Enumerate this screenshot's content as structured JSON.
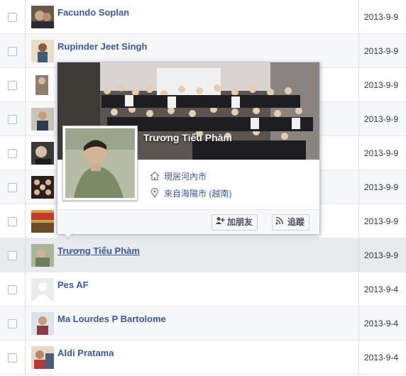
{
  "rows": [
    {
      "name": "Facundo Soplan",
      "date": "2013-9-9",
      "avatar": "photo"
    },
    {
      "name": "Rupinder Jeet Singh",
      "date": "2013-9-9",
      "avatar": "photo"
    },
    {
      "name": "",
      "date": "2013-9-9",
      "avatar": "photo"
    },
    {
      "name": "",
      "date": "2013-9-9",
      "avatar": "photo"
    },
    {
      "name": "",
      "date": "2013-9-9",
      "avatar": "photo"
    },
    {
      "name": "",
      "date": "2013-9-9",
      "avatar": "photo"
    },
    {
      "name": "",
      "date": "2013-9-9",
      "avatar": "photo"
    },
    {
      "name": "Trương Tiểu Phàm",
      "date": "2013-9-9",
      "avatar": "photo"
    },
    {
      "name": "Pes AF",
      "date": "2013-9-4",
      "avatar": "default-silhouette"
    },
    {
      "name": "Ma Lourdes P Bartolome",
      "date": "2013-9-4",
      "avatar": "photo"
    },
    {
      "name": "Aldi Pratama",
      "date": "2013-9-4",
      "avatar": "photo"
    }
  ],
  "hovercard": {
    "name": "Trương Tiểu Phàm",
    "lives_in": "現居河內市",
    "from": "來自海陽市 (越南)",
    "add_friend_label": "加朋友",
    "follow_label": "追蹤"
  },
  "colors": {
    "link": "#3b5998",
    "row_alt": "#f6f7f9",
    "row_highlight": "#e9eaed",
    "border": "#dddfe2"
  }
}
